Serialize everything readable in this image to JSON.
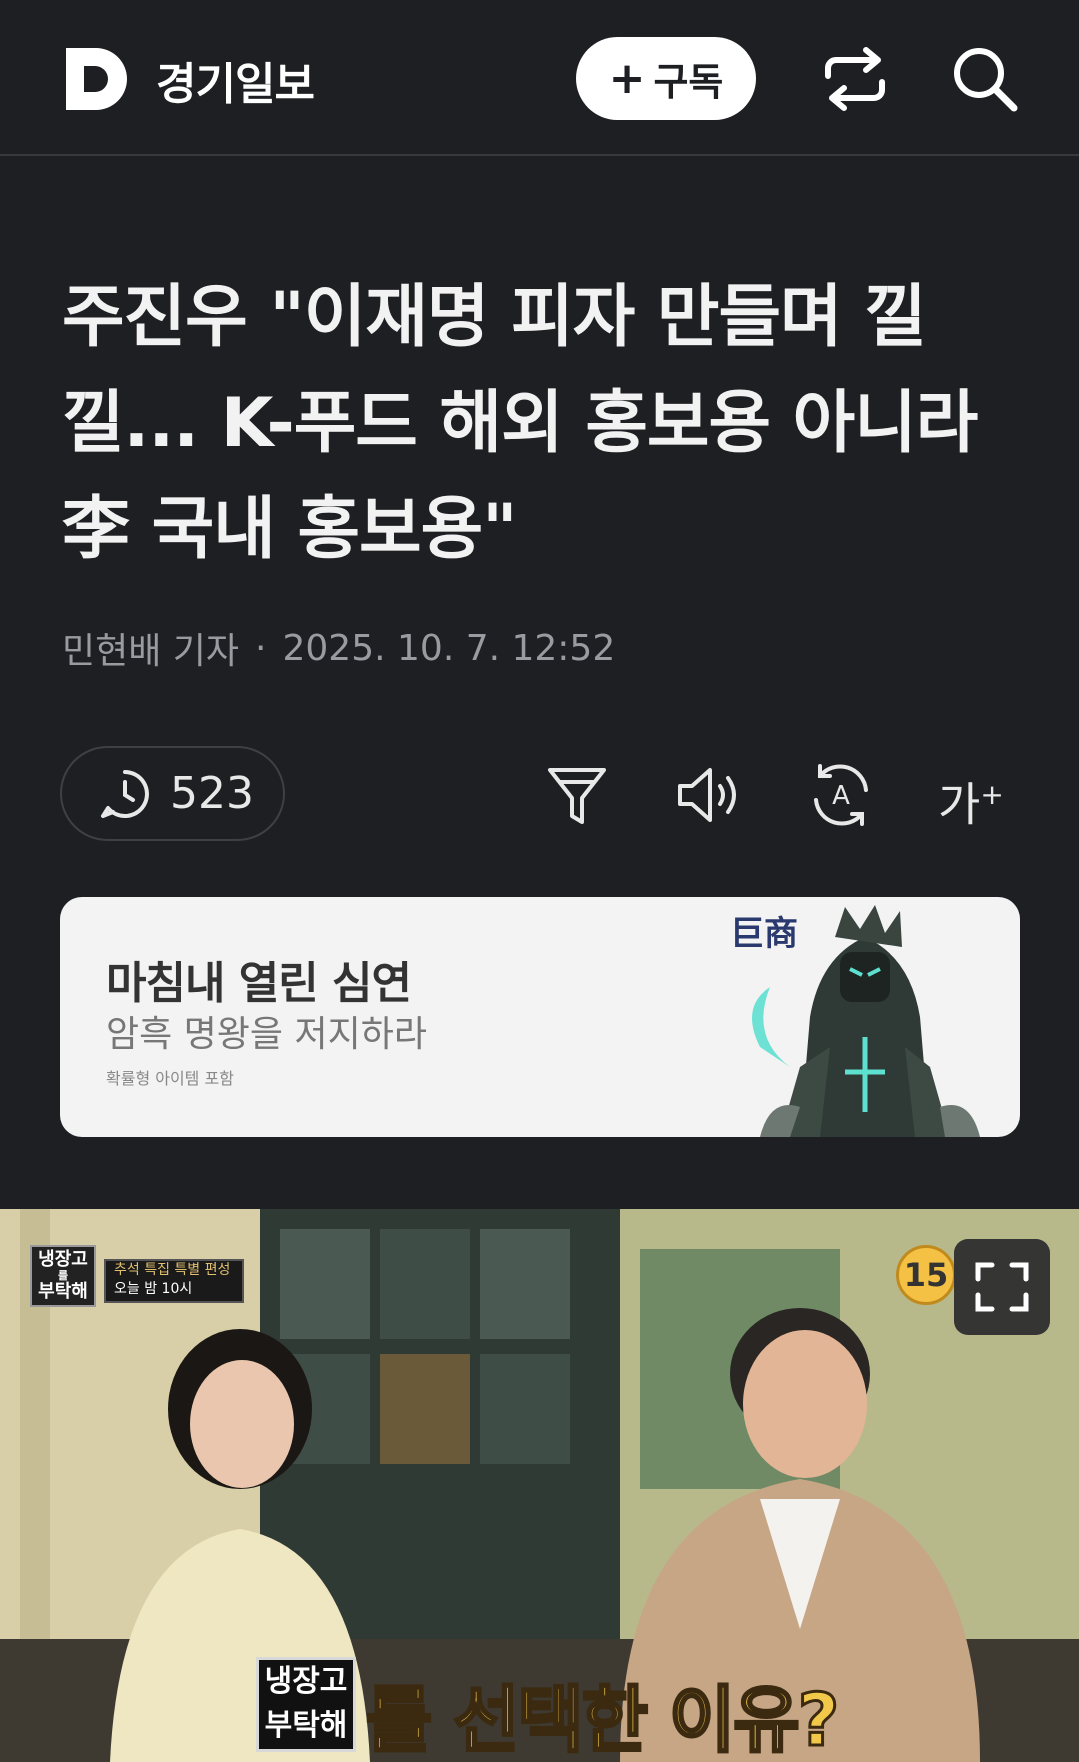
{
  "header": {
    "brand": "경기일보",
    "subscribe_label": "구독",
    "subscribe_icon": "plus-icon",
    "share_icon": "share-icon",
    "search_icon": "search-icon"
  },
  "article": {
    "headline_line1": "주진우 \"이재명 피자 만들며 낄",
    "headline_line2": "낄... K-푸드 해외 홍보용 아니라",
    "headline_line3": "李 국내 홍보용\"",
    "author": "민현배 기자",
    "separator": "·",
    "datetime": "2025. 10. 7. 12:52"
  },
  "toolbar": {
    "comment_count": "523",
    "comment_icon": "comment-icon",
    "summary_icon": "filter-summary-icon",
    "audio_icon": "speaker-icon",
    "translate_icon": "translate-icon",
    "font_size_label": "가",
    "font_size_sup": "+"
  },
  "ad": {
    "title": "마침내 열린 심연",
    "subtitle": "암흑 명왕을 저지하라",
    "note": "확률형 아이템 포함",
    "logo_text": "巨商"
  },
  "photo": {
    "rating": "15",
    "show_logo_line1": "냉장고",
    "show_logo_line2": "를",
    "show_logo_line3": "부탁해",
    "show_tag_line1": "추석 특집 특별 편성",
    "show_tag_line2": "오늘 밤 10시",
    "caption_logo_line1": "냉장고",
    "caption_logo_line2": "부탁해",
    "caption_text": "를 선택한 이유?",
    "expand_icon": "expand-icon"
  },
  "colors": {
    "background": "#1e1f22",
    "text_primary": "#f2f2f2",
    "text_muted": "#9a9ba0",
    "ad_background": "#f3f3f3",
    "caption_yellow": "#f2c84b"
  }
}
